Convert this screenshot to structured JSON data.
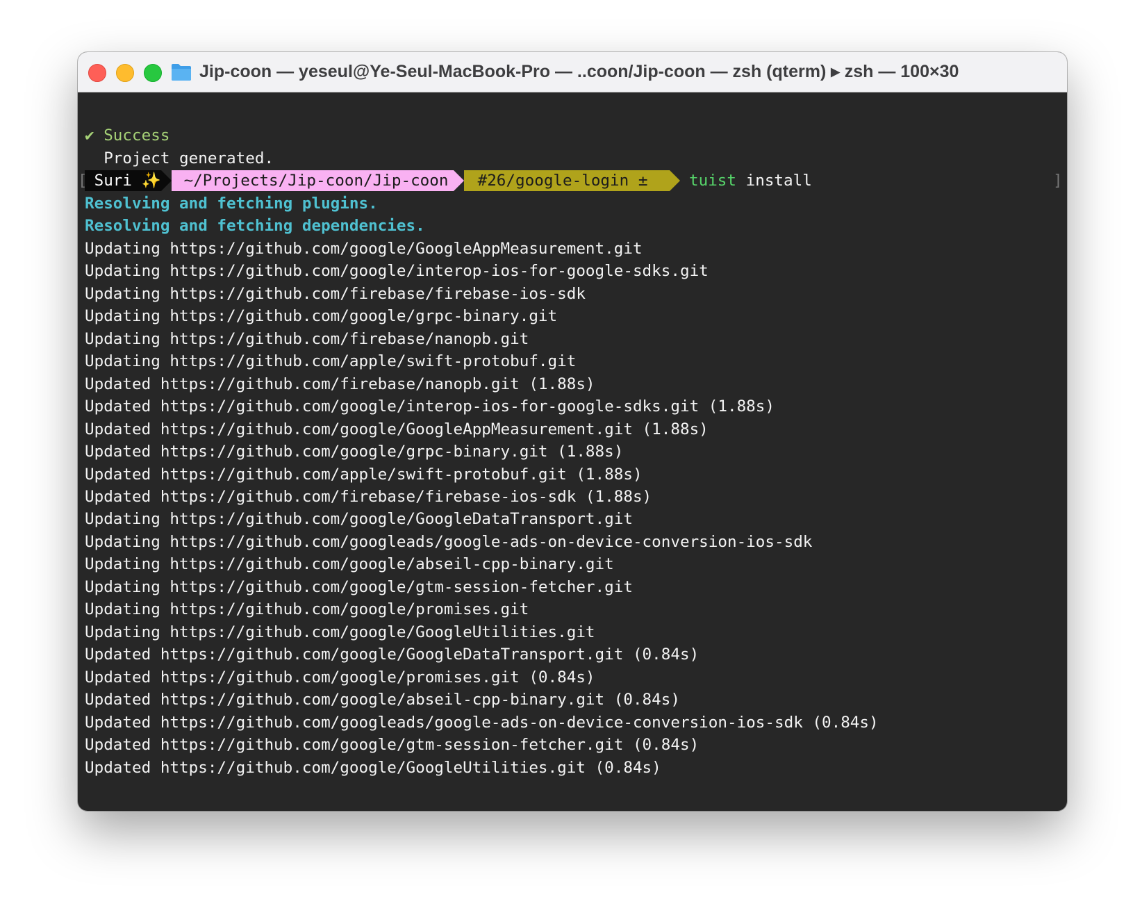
{
  "window": {
    "title": "Jip-coon — yeseul@Ye-Seul-MacBook-Pro — ..coon/Jip-coon — zsh (qterm) ▸ zsh — 100×30",
    "icons": {
      "close": "close-button",
      "minimize": "minimize-button",
      "maximize": "zoom-button",
      "folder": "folder-icon"
    },
    "colors": {
      "close": "#fe5f57",
      "minimize": "#febc2e",
      "maximize": "#28c840",
      "background": "#272727"
    }
  },
  "terminal": {
    "success_line": "✔ Success",
    "generated_line": "  Project generated.",
    "prompt": {
      "user": " Suri ",
      "user_emoji": "✨",
      "directory": " ~/Projects/Jip-coon/Jip-coon ",
      "branch_icon": "",
      "branch": " #26/google-login ± ",
      "command_name": "tuist",
      "command_args": " install",
      "left_bracket": "[",
      "right_bracket": "]",
      "colors": {
        "user_bg": "#0a0a0a",
        "dir_bg": "#f9b1f2",
        "git_bg": "#b0a31b"
      }
    },
    "resolving_plugins": "Resolving and fetching plugins.",
    "resolving_dependencies": "Resolving and fetching dependencies.",
    "output_lines": [
      "Updating https://github.com/google/GoogleAppMeasurement.git",
      "Updating https://github.com/google/interop-ios-for-google-sdks.git",
      "Updating https://github.com/firebase/firebase-ios-sdk",
      "Updating https://github.com/google/grpc-binary.git",
      "Updating https://github.com/firebase/nanopb.git",
      "Updating https://github.com/apple/swift-protobuf.git",
      "Updated https://github.com/firebase/nanopb.git (1.88s)",
      "Updated https://github.com/google/interop-ios-for-google-sdks.git (1.88s)",
      "Updated https://github.com/google/GoogleAppMeasurement.git (1.88s)",
      "Updated https://github.com/google/grpc-binary.git (1.88s)",
      "Updated https://github.com/apple/swift-protobuf.git (1.88s)",
      "Updated https://github.com/firebase/firebase-ios-sdk (1.88s)",
      "Updating https://github.com/google/GoogleDataTransport.git",
      "Updating https://github.com/googleads/google-ads-on-device-conversion-ios-sdk",
      "Updating https://github.com/google/abseil-cpp-binary.git",
      "Updating https://github.com/google/gtm-session-fetcher.git",
      "Updating https://github.com/google/promises.git",
      "Updating https://github.com/google/GoogleUtilities.git",
      "Updated https://github.com/google/GoogleDataTransport.git (0.84s)",
      "Updated https://github.com/google/promises.git (0.84s)",
      "Updated https://github.com/google/abseil-cpp-binary.git (0.84s)",
      "Updated https://github.com/googleads/google-ads-on-device-conversion-ios-sdk (0.84s)",
      "Updated https://github.com/google/gtm-session-fetcher.git (0.84s)",
      "Updated https://github.com/google/GoogleUtilities.git (0.84s)"
    ]
  }
}
